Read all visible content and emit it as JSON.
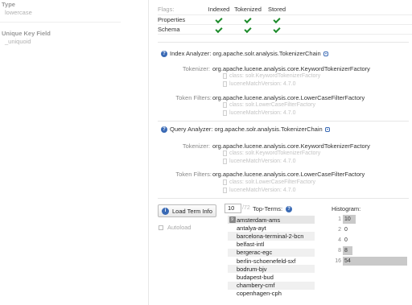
{
  "left_panel": {
    "type_label": "Type",
    "type_value": "lowercase",
    "unique_key_label": "Unique Key Field",
    "unique_key_value": "_uniquoid"
  },
  "flags_table": {
    "header_label": "Flags:",
    "columns": [
      "Indexed",
      "Tokenized",
      "Stored"
    ],
    "rows": [
      {
        "label": "Properties",
        "checks": [
          true,
          true,
          true
        ]
      },
      {
        "label": "Schema",
        "checks": [
          true,
          true,
          true
        ]
      }
    ]
  },
  "index_analyzer": {
    "title_label": "Index Analyzer:",
    "title_value": "org.apache.solr.analysis.TokenizerChain",
    "tokenizer_label": "Tokenizer:",
    "tokenizer_value": "org.apache.lucene.analysis.core.KeywordTokenizerFactory",
    "tokenizer_class": "class: solr.KeywordTokenizerFactory",
    "tokenizer_version": "luceneMatchVersion: 4.7.0",
    "filter_label": "Token Filters:",
    "filter_value": "org.apache.lucene.analysis.core.LowerCaseFilterFactory",
    "filter_class": "class: solr.LowerCaseFilterFactory",
    "filter_version": "luceneMatchVersion: 4.7.0"
  },
  "query_analyzer": {
    "title_label": "Query Analyzer:",
    "title_value": "org.apache.solr.analysis.TokenizerChain",
    "tokenizer_label": "Tokenizer:",
    "tokenizer_value": "org.apache.lucene.analysis.core.KeywordTokenizerFactory",
    "tokenizer_class": "class: solr.KeywordTokenizerFactory",
    "tokenizer_version": "luceneMatchVersion: 4.7.0",
    "filter_label": "Token Filters:",
    "filter_value": "org.apache.lucene.analysis.core.LowerCaseFilterFactory",
    "filter_class": "class: solr.LowerCaseFilterFactory",
    "filter_version": "luceneMatchVersion: 4.7.0"
  },
  "term_info": {
    "load_button": "Load Term Info",
    "autoload_label": "Autoload",
    "top_terms_value": "10",
    "top_terms_of": "/72",
    "top_terms_label": "Top-Terms:",
    "terms": [
      {
        "key": "9",
        "term": "amsterdam-ams"
      },
      {
        "key": "",
        "term": "antalya-ayt"
      },
      {
        "key": "",
        "term": "barcelona-terminal-2-bcn"
      },
      {
        "key": "",
        "term": "belfast-intl"
      },
      {
        "key": "",
        "term": "bergerac-egc"
      },
      {
        "key": "",
        "term": "berlin-schoenefeld-sxf"
      },
      {
        "key": "",
        "term": "bodrum-bjv"
      },
      {
        "key": "",
        "term": "budapest-bud"
      },
      {
        "key": "",
        "term": "chambery-cmf"
      },
      {
        "key": "",
        "term": "copenhagen-cph"
      }
    ],
    "histogram_label": "Histogram:",
    "histogram": [
      {
        "key": "1",
        "count": "10",
        "fraction": 0.2
      },
      {
        "key": "2",
        "count": "0",
        "fraction": 0.0
      },
      {
        "key": "4",
        "count": "0",
        "fraction": 0.0
      },
      {
        "key": "8",
        "count": "8",
        "fraction": 0.15
      },
      {
        "key": "16",
        "count": "54",
        "fraction": 1.0
      }
    ]
  }
}
